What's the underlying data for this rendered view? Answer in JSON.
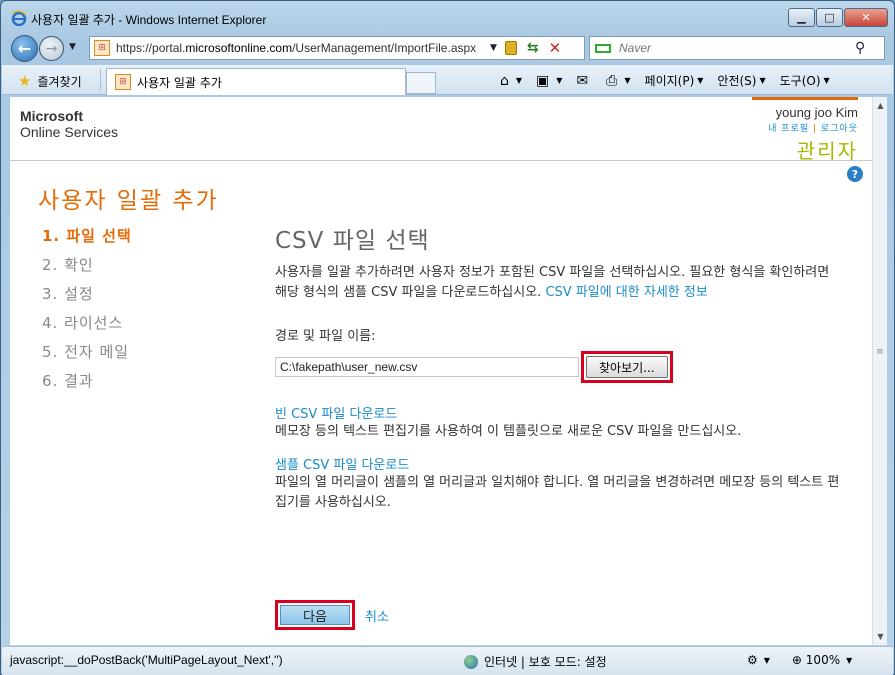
{
  "window": {
    "title": "사용자 일괄 추가 - Windows Internet Explorer"
  },
  "nav": {
    "url_prefix": "https://portal.",
    "url_domain": "microsoftonline.com",
    "url_rest": "/UserManagement/ImportFile.aspx",
    "search_placeholder": "Naver"
  },
  "commandbar": {
    "favorites_label": "즐겨찾기",
    "tab_title": "사용자 일괄 추가",
    "page_menu": "페이지(P)",
    "safety_menu": "안전(S)",
    "tools_menu": "도구(O)"
  },
  "header": {
    "logo_line1": "Microsoft",
    "logo_line2": "Online Services",
    "user_name": "young joo Kim",
    "profile_link": "내 프로필",
    "logout_link": "로그아웃",
    "role": "관리자",
    "help_glyph": "?"
  },
  "page": {
    "title": "사용자 일괄 추가",
    "steps": [
      "1. 파일 선택",
      "2. 확인",
      "3. 설정",
      "4. 라이선스",
      "5. 전자 메일",
      "6. 결과"
    ]
  },
  "main": {
    "heading": "CSV 파일 선택",
    "description": "사용자를 일괄 추가하려면 사용자 정보가 포함된 CSV 파일을 선택하십시오. 필요한 형식을 확인하려면 해당 형식의 샘플 CSV 파일을 다운로드하십시오.",
    "info_link": "CSV 파일에 대한 자세한 정보",
    "path_label": "경로 및 파일 이름:",
    "file_value": "C:\\fakepath\\user_new.csv",
    "browse_label": "찾아보기...",
    "blank_csv_link": "빈 CSV 파일 다운로드",
    "blank_csv_desc": "메모장 등의 텍스트 편집기를 사용하여 이 템플릿으로 새로운 CSV 파일을 만드십시오.",
    "sample_csv_link": "샘플 CSV 파일 다운로드",
    "sample_csv_desc": "파일의 열 머리글이 샘플의 열 머리글과 일치해야 합니다. 열 머리글을 변경하려면 메모장 등의 텍스트 편집기를 사용하십시오.",
    "next_label": "다음",
    "cancel_label": "취소"
  },
  "status": {
    "text": "javascript:__doPostBack('MultiPageLayout_Next','')",
    "zone": "인터넷 | 보호 모드: 설정",
    "zoom": "100%"
  },
  "colors": {
    "accent_orange": "#e36c09",
    "link_blue": "#1a8ccc",
    "highlight_red": "#d8001c",
    "role_green": "#a8b800"
  }
}
